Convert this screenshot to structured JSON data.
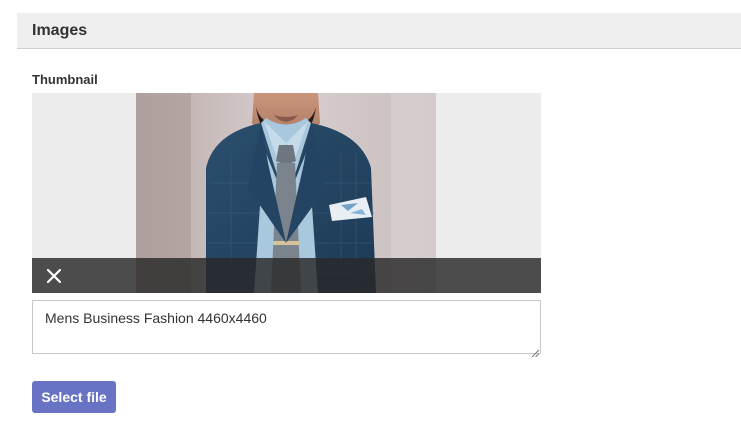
{
  "section": {
    "title": "Images"
  },
  "thumbnail": {
    "label": "Thumbnail",
    "caption_value": "Mens Business Fashion 4460x4460",
    "remove_icon": "close-icon"
  },
  "actions": {
    "select_file_label": "Select file"
  },
  "colors": {
    "header_bg": "#efefef",
    "button_bg": "#6873c4",
    "overlay_bar": "#282828"
  }
}
